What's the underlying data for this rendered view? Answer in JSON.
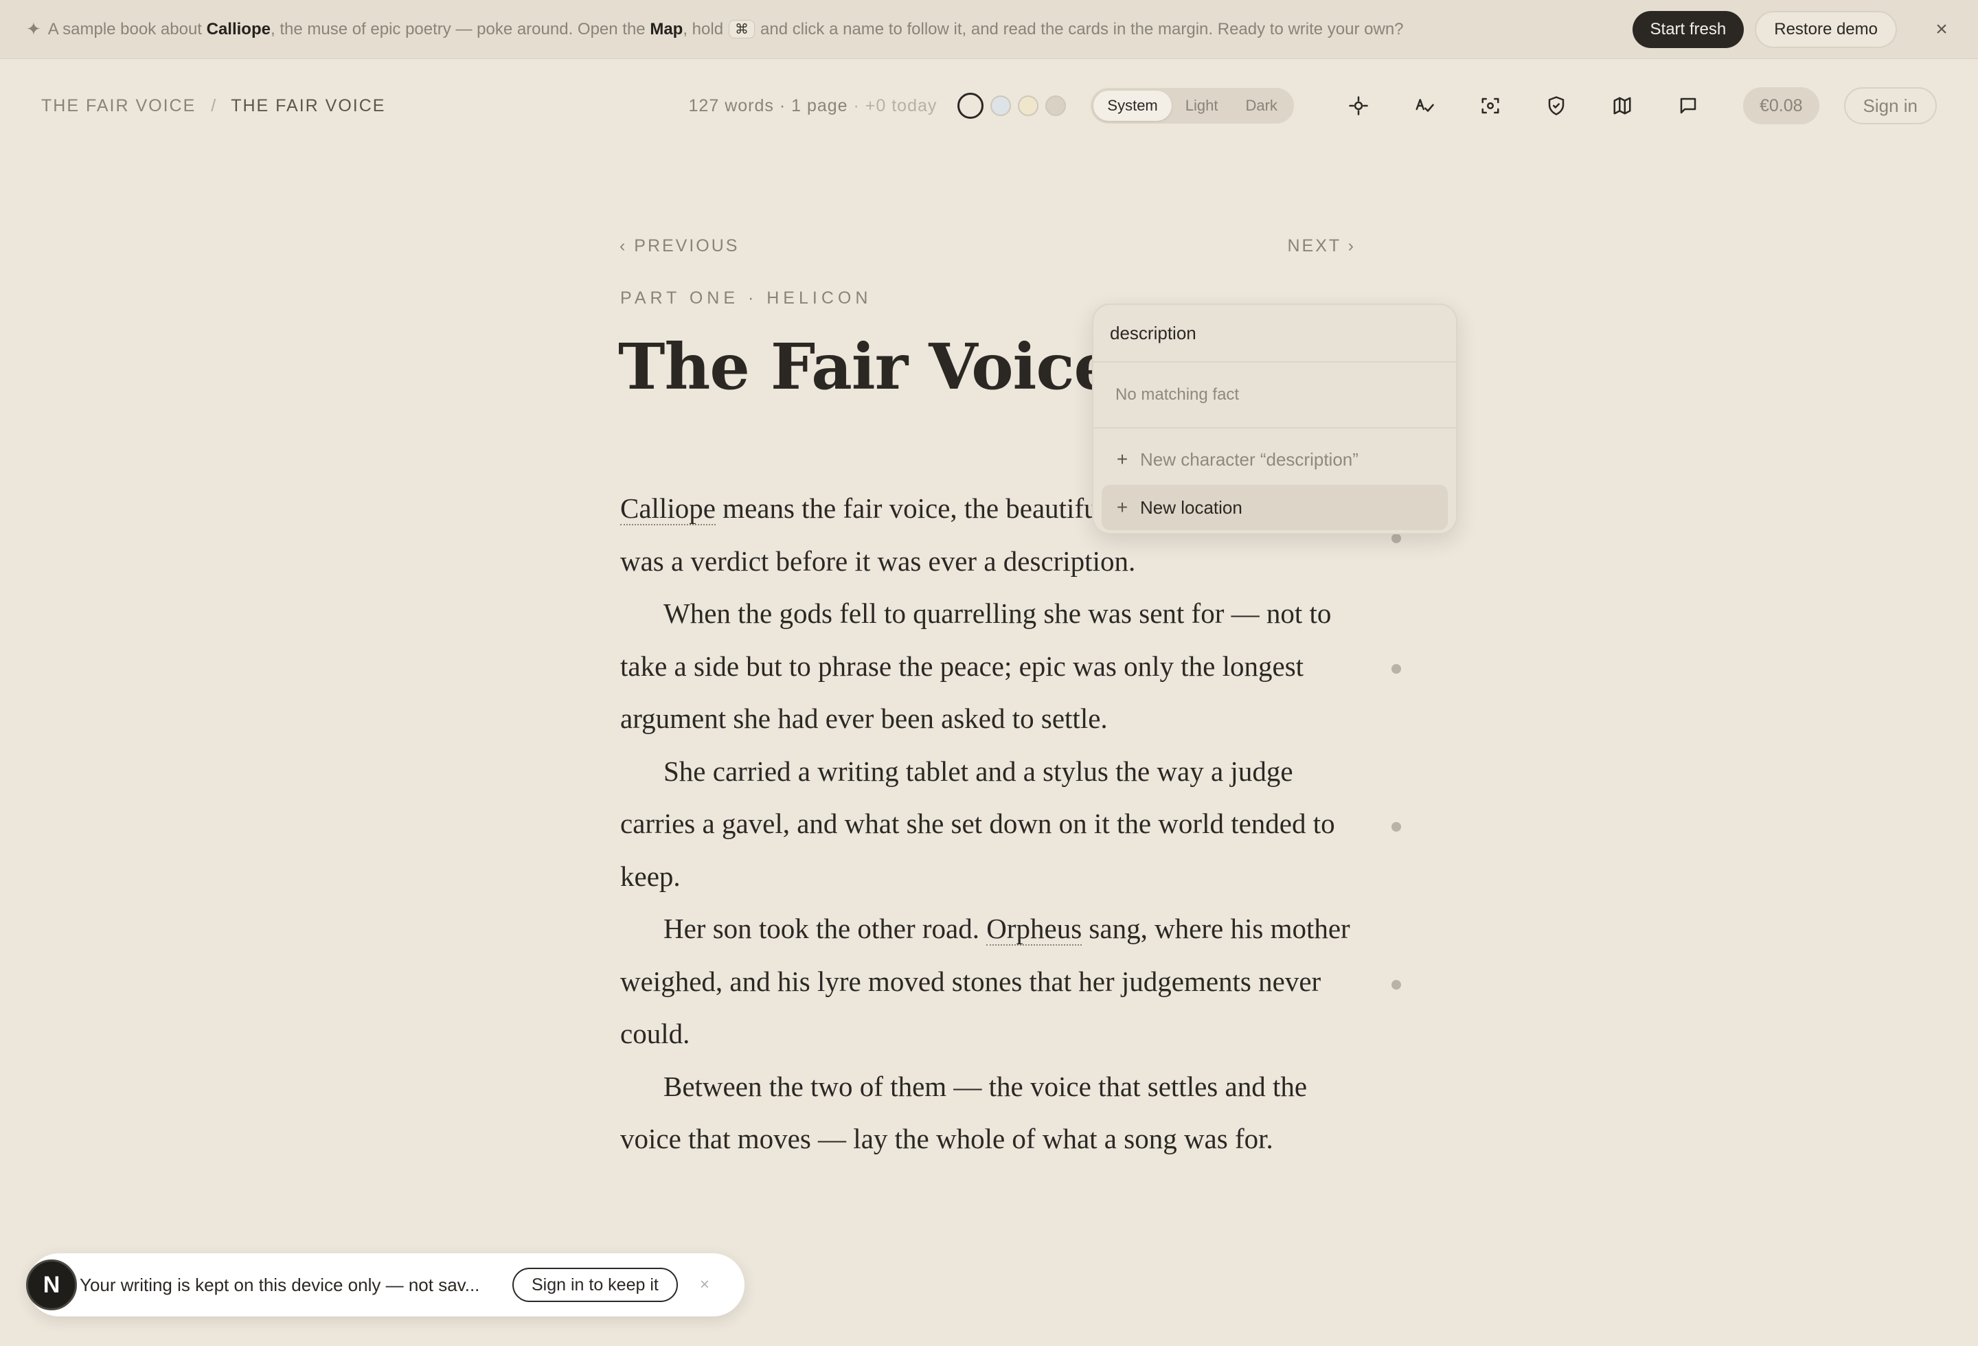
{
  "banner": {
    "spark": "✦",
    "text_1": "A sample book about",
    "name_calliope": "Calliope",
    "text_2": ", the muse of epic poetry — poke around. Open the",
    "map_word": "Map",
    "text_3": ", hold",
    "kbd": "⌘",
    "text_4": "and click a name to follow it, and read the cards in the margin. Ready to write your own?",
    "start_fresh": "Start fresh",
    "restore_demo": "Restore demo",
    "close": "×"
  },
  "header": {
    "breadcrumb": [
      "THE FAIR VOICE",
      "THE FAIR VOICE"
    ],
    "breadcrumb_sep": "/",
    "stats_main": "127 words · 1 page",
    "stats_today": "· +0 today",
    "swatch_colors": [
      "#ece6db",
      "#dde3e6",
      "#efe6cc",
      "#d9d1c3"
    ],
    "theme_options": [
      "System",
      "Light",
      "Dark"
    ],
    "theme_selected": "System",
    "icons": [
      "focus-icon",
      "spellcheck-icon",
      "capture-icon",
      "shield-icon",
      "map-icon",
      "comment-icon"
    ],
    "credit": "€0.08",
    "sign_in": "Sign in"
  },
  "page": {
    "prev": "‹ PREVIOUS",
    "next": "NEXT ›",
    "kicker": "PART ONE · HELICON",
    "title": "The Fair Voice",
    "p1_entity": "Calliope",
    "p1_rest": " means the fair voice, the beautiful voice, and her name was a verdict before it was ever a description.",
    "p2": "When the gods fell to quarrelling she was sent for — not to take a side but to phrase the peace; epic was only the longest argument she had ever been asked to settle.",
    "p3": "She carried a writing tablet and a stylus the way a judge carries a gavel, and what she set down on it the world tended to keep.",
    "p4_a": "Her son took the other road. ",
    "p4_entity": "Orpheus",
    "p4_b": " sang, where his mother weighed, and his lyre moved stones that her judgements never could.",
    "p5": "Between the two of them — the voice that settles and the voice that moves — lay the whole of what a song was for."
  },
  "popup": {
    "query": "description",
    "no_match": "No matching fact",
    "options": [
      {
        "label": "New character “description”",
        "selected": false
      },
      {
        "label": "New location",
        "selected": true
      }
    ],
    "plus": "+"
  },
  "toast": {
    "avatar": "N",
    "message": "Your writing is kept on this device only — not sav...",
    "button": "Sign in to keep it",
    "close": "×"
  }
}
